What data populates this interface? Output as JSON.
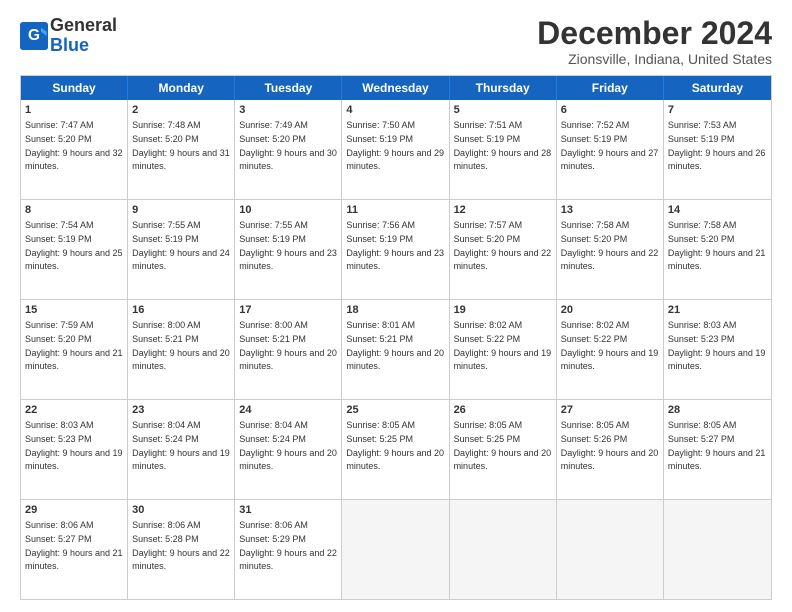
{
  "header": {
    "logo_line1": "General",
    "logo_line2": "Blue",
    "title": "December 2024",
    "subtitle": "Zionsville, Indiana, United States"
  },
  "weekdays": [
    "Sunday",
    "Monday",
    "Tuesday",
    "Wednesday",
    "Thursday",
    "Friday",
    "Saturday"
  ],
  "rows": [
    [
      {
        "day": "1",
        "rise": "7:47 AM",
        "set": "5:20 PM",
        "daylight": "9 hours and 32 minutes."
      },
      {
        "day": "2",
        "rise": "7:48 AM",
        "set": "5:20 PM",
        "daylight": "9 hours and 31 minutes."
      },
      {
        "day": "3",
        "rise": "7:49 AM",
        "set": "5:20 PM",
        "daylight": "9 hours and 30 minutes."
      },
      {
        "day": "4",
        "rise": "7:50 AM",
        "set": "5:19 PM",
        "daylight": "9 hours and 29 minutes."
      },
      {
        "day": "5",
        "rise": "7:51 AM",
        "set": "5:19 PM",
        "daylight": "9 hours and 28 minutes."
      },
      {
        "day": "6",
        "rise": "7:52 AM",
        "set": "5:19 PM",
        "daylight": "9 hours and 27 minutes."
      },
      {
        "day": "7",
        "rise": "7:53 AM",
        "set": "5:19 PM",
        "daylight": "9 hours and 26 minutes."
      }
    ],
    [
      {
        "day": "8",
        "rise": "7:54 AM",
        "set": "5:19 PM",
        "daylight": "9 hours and 25 minutes."
      },
      {
        "day": "9",
        "rise": "7:55 AM",
        "set": "5:19 PM",
        "daylight": "9 hours and 24 minutes."
      },
      {
        "day": "10",
        "rise": "7:55 AM",
        "set": "5:19 PM",
        "daylight": "9 hours and 23 minutes."
      },
      {
        "day": "11",
        "rise": "7:56 AM",
        "set": "5:19 PM",
        "daylight": "9 hours and 23 minutes."
      },
      {
        "day": "12",
        "rise": "7:57 AM",
        "set": "5:20 PM",
        "daylight": "9 hours and 22 minutes."
      },
      {
        "day": "13",
        "rise": "7:58 AM",
        "set": "5:20 PM",
        "daylight": "9 hours and 22 minutes."
      },
      {
        "day": "14",
        "rise": "7:58 AM",
        "set": "5:20 PM",
        "daylight": "9 hours and 21 minutes."
      }
    ],
    [
      {
        "day": "15",
        "rise": "7:59 AM",
        "set": "5:20 PM",
        "daylight": "9 hours and 21 minutes."
      },
      {
        "day": "16",
        "rise": "8:00 AM",
        "set": "5:21 PM",
        "daylight": "9 hours and 20 minutes."
      },
      {
        "day": "17",
        "rise": "8:00 AM",
        "set": "5:21 PM",
        "daylight": "9 hours and 20 minutes."
      },
      {
        "day": "18",
        "rise": "8:01 AM",
        "set": "5:21 PM",
        "daylight": "9 hours and 20 minutes."
      },
      {
        "day": "19",
        "rise": "8:02 AM",
        "set": "5:22 PM",
        "daylight": "9 hours and 19 minutes."
      },
      {
        "day": "20",
        "rise": "8:02 AM",
        "set": "5:22 PM",
        "daylight": "9 hours and 19 minutes."
      },
      {
        "day": "21",
        "rise": "8:03 AM",
        "set": "5:23 PM",
        "daylight": "9 hours and 19 minutes."
      }
    ],
    [
      {
        "day": "22",
        "rise": "8:03 AM",
        "set": "5:23 PM",
        "daylight": "9 hours and 19 minutes."
      },
      {
        "day": "23",
        "rise": "8:04 AM",
        "set": "5:24 PM",
        "daylight": "9 hours and 19 minutes."
      },
      {
        "day": "24",
        "rise": "8:04 AM",
        "set": "5:24 PM",
        "daylight": "9 hours and 20 minutes."
      },
      {
        "day": "25",
        "rise": "8:05 AM",
        "set": "5:25 PM",
        "daylight": "9 hours and 20 minutes."
      },
      {
        "day": "26",
        "rise": "8:05 AM",
        "set": "5:25 PM",
        "daylight": "9 hours and 20 minutes."
      },
      {
        "day": "27",
        "rise": "8:05 AM",
        "set": "5:26 PM",
        "daylight": "9 hours and 20 minutes."
      },
      {
        "day": "28",
        "rise": "8:05 AM",
        "set": "5:27 PM",
        "daylight": "9 hours and 21 minutes."
      }
    ],
    [
      {
        "day": "29",
        "rise": "8:06 AM",
        "set": "5:27 PM",
        "daylight": "9 hours and 21 minutes."
      },
      {
        "day": "30",
        "rise": "8:06 AM",
        "set": "5:28 PM",
        "daylight": "9 hours and 22 minutes."
      },
      {
        "day": "31",
        "rise": "8:06 AM",
        "set": "5:29 PM",
        "daylight": "9 hours and 22 minutes."
      },
      null,
      null,
      null,
      null
    ]
  ]
}
